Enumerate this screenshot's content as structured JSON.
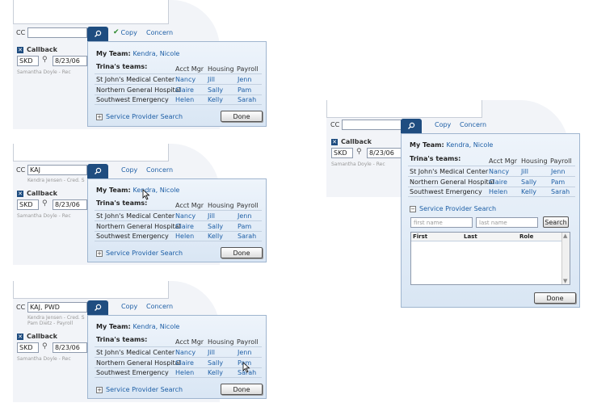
{
  "cc": {
    "label": "CC",
    "copy": "Copy",
    "concern": "Concern"
  },
  "callback": {
    "label": "Callback",
    "initials": "SKD",
    "date": "8/23/06",
    "rep": "Samantha Doyle - Rec"
  },
  "popup": {
    "my_team_label": "My Team:",
    "my_team_names": "Kendra, Nicole",
    "teams_label": "Trina's teams:",
    "columns": [
      "Acct Mgr",
      "Housing",
      "Payroll"
    ],
    "rows": [
      {
        "name": "St John's Medical Center",
        "acct": "Nancy",
        "housing": "Jill",
        "payroll": "Jenn"
      },
      {
        "name": "Northern General Hospital",
        "acct": "Claire",
        "housing": "Sally",
        "payroll": "Pam"
      },
      {
        "name": "Southwest Emergency",
        "acct": "Helen",
        "housing": "Kelly",
        "payroll": "Sarah"
      }
    ],
    "sps_label": "Service Provider Search",
    "done": "Done"
  },
  "panel2": {
    "cc_value": "KAJ",
    "hint": "Kendra Jensen - Cred. S"
  },
  "panel3": {
    "cc_value": "KAJ, PWD",
    "hint1": "Kendra Jensen - Cred. S",
    "hint2": "Pam Dietz - Payroll"
  },
  "search": {
    "first_placeholder": "first name",
    "last_placeholder": "last name",
    "button": "Search",
    "cols": [
      "First",
      "Last",
      "Role"
    ]
  },
  "colors": {
    "accent": "#1f4d80",
    "link": "#1e5fa6"
  }
}
